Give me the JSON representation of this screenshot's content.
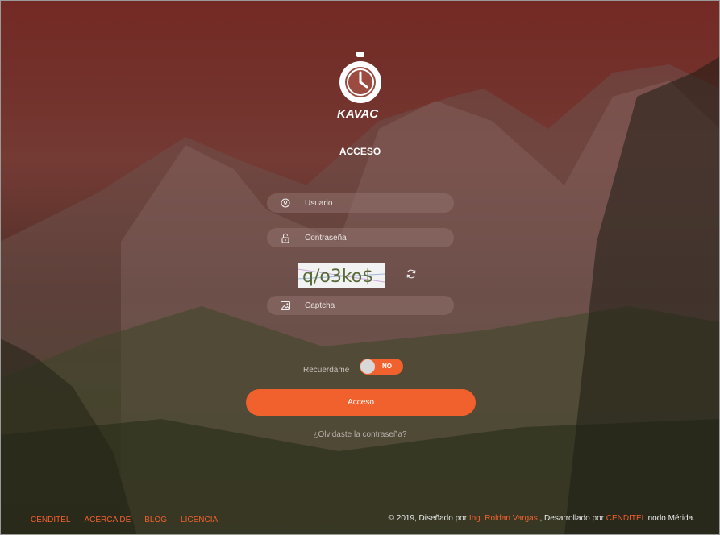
{
  "brand": {
    "logo_text": "KAVAC"
  },
  "form": {
    "title": "ACCESO",
    "username": {
      "placeholder": "Usuario"
    },
    "password": {
      "placeholder": "Contraseña"
    },
    "captcha": {
      "image_text": "q/o3ko$",
      "placeholder": "Captcha"
    },
    "remember": {
      "label": "Recuerdame",
      "toggle_state": "NO"
    },
    "submit_label": "Acceso",
    "forgot_label": "¿Olvidaste la contraseña?"
  },
  "footer": {
    "links": [
      "CENDITEL",
      "ACERCA DE",
      "BLOG",
      "LICENCIA"
    ],
    "copyright": {
      "prefix": "© 2019, Diseñado por ",
      "designer": "Ing. Roldan Vargas",
      "middle": " , Desarrollado por ",
      "developer": "CENDITEL",
      "suffix": " nodo Mérida."
    }
  },
  "colors": {
    "accent": "#f0612d",
    "overlay": "#7a2a24"
  }
}
